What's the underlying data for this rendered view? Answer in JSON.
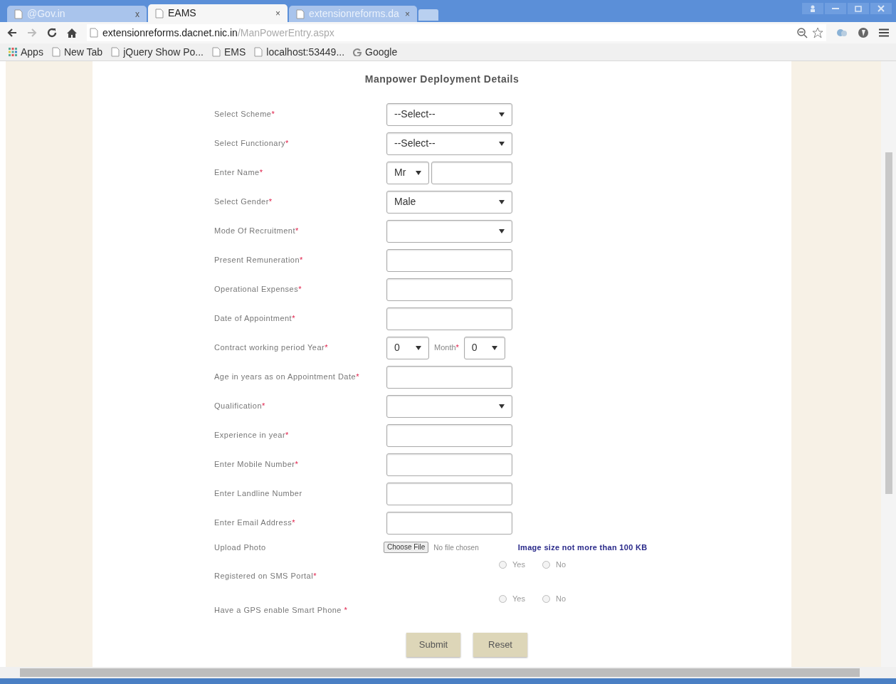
{
  "browser": {
    "tabs": [
      {
        "title": "@Gov.in",
        "close": "x",
        "selected": false
      },
      {
        "title": "EAMS",
        "close": "×",
        "selected": true
      },
      {
        "title": "extensionreforms.da",
        "close": "×",
        "selected": false
      }
    ],
    "url": {
      "host": "extensionreforms.dacnet.nic.in",
      "path": "/ManPowerEntry.aspx"
    },
    "bookmarks": [
      {
        "label": "Apps",
        "kind": "apps"
      },
      {
        "label": "New Tab",
        "kind": "page"
      },
      {
        "label": "jQuery Show Po...",
        "kind": "page"
      },
      {
        "label": "EMS",
        "kind": "page"
      },
      {
        "label": "localhost:53449...",
        "kind": "page"
      },
      {
        "label": "Google",
        "kind": "google"
      }
    ]
  },
  "form": {
    "title": "Manpower Deployment Details",
    "rows": [
      {
        "kind": "select",
        "label": "Select Scheme",
        "mark": "*",
        "value": "--Select--"
      },
      {
        "kind": "select",
        "label": "Select Functionary",
        "mark": "*",
        "value": "--Select--"
      },
      {
        "kind": "name",
        "label": "Enter Name",
        "mark": "*",
        "title": "Mr"
      },
      {
        "kind": "select",
        "label": "Select Gender",
        "mark": "*",
        "value": "Male"
      },
      {
        "kind": "select",
        "label": "Mode Of Recruitment",
        "mark": "*"
      },
      {
        "kind": "input",
        "label": "Present Remuneration",
        "mark": "*"
      },
      {
        "kind": "input",
        "label": "Operational Expenses",
        "mark": "*"
      },
      {
        "kind": "input",
        "label": "Date of Appointment",
        "mark": "*"
      },
      {
        "kind": "period",
        "label": "Contract working period Year",
        "mark": "*",
        "year": "0",
        "month_label": "Month",
        "month_mark": "*",
        "month": "0"
      },
      {
        "kind": "input",
        "label": "Age in years as on Appointment Date",
        "mark": "*"
      },
      {
        "kind": "select",
        "label": "Qualification",
        "mark": "*"
      },
      {
        "kind": "input",
        "label": "Experience in year",
        "mark": "*"
      },
      {
        "kind": "input",
        "label": "Enter Mobile Number",
        "mark": "*"
      },
      {
        "kind": "input",
        "label": "Enter Landline Number"
      },
      {
        "kind": "input",
        "label": "Enter Email Address",
        "mark": "*"
      },
      {
        "kind": "file",
        "label": "Upload Photo",
        "button": "Choose File",
        "status": "No file chosen",
        "note": "Image size not more than 100 KB"
      },
      {
        "kind": "radio",
        "label": "Registered on SMS Portal",
        "mark": "*",
        "options": [
          {
            "label": "Yes",
            "selected": false
          },
          {
            "label": "No",
            "selected": false
          }
        ]
      },
      {
        "kind": "radio",
        "label": "Have a GPS enable Smart Phone ",
        "mark": "*",
        "options": [
          {
            "label": "Yes",
            "selected": false
          },
          {
            "label": "No",
            "selected": false
          }
        ]
      }
    ],
    "buttons": [
      "Submit",
      "Reset"
    ]
  }
}
